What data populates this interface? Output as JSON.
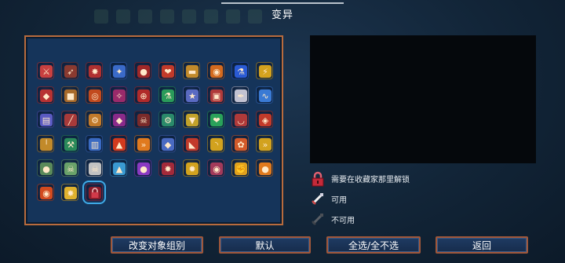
{
  "title": "变异",
  "grid": {
    "items": [
      {
        "name": "sword-mutation-icon",
        "glyph": "⚔",
        "color": "#c94040"
      },
      {
        "name": "crossbow-mutation-icon",
        "glyph": "➶",
        "color": "#8a3a30"
      },
      {
        "name": "spider-mutation-icon",
        "glyph": "✸",
        "color": "#b03030"
      },
      {
        "name": "blade-blue-mutation-icon",
        "glyph": "✦",
        "color": "#3a6ac9"
      },
      {
        "name": "red-orb-mutation-icon",
        "glyph": "●",
        "color": "#a02828"
      },
      {
        "name": "fire-heart-mutation-icon",
        "glyph": "❤",
        "color": "#c23a2a"
      },
      {
        "name": "gun-mutation-icon",
        "glyph": "▬",
        "color": "#c28a2a"
      },
      {
        "name": "pumpkin-mutation-icon",
        "glyph": "◉",
        "color": "#d46a1e"
      },
      {
        "name": "potion-blue-mutation-icon",
        "glyph": "⚗",
        "color": "#2a5ad4"
      },
      {
        "name": "lightning-mutation-icon",
        "glyph": "⚡",
        "color": "#d4a21e"
      },
      {
        "name": "shield-mutation-icon",
        "glyph": "◆",
        "color": "#b83232"
      },
      {
        "name": "barrel-mutation-icon",
        "glyph": "■",
        "color": "#a86a2a"
      },
      {
        "name": "ring-mutation-icon",
        "glyph": "◎",
        "color": "#c24a1e"
      },
      {
        "name": "claw-mutation-icon",
        "glyph": "✧",
        "color": "#9a2a6a"
      },
      {
        "name": "target-mutation-icon",
        "glyph": "⊕",
        "color": "#b02a2a"
      },
      {
        "name": "potion-green-mutation-icon",
        "glyph": "⚗",
        "color": "#2a9a5a"
      },
      {
        "name": "star-mutation-icon",
        "glyph": "★",
        "color": "#5a6ac2"
      },
      {
        "name": "chest-mutation-icon",
        "glyph": "▣",
        "color": "#b03a3a"
      },
      {
        "name": "key-mutation-icon",
        "glyph": "✒",
        "color": "#c2c2d2"
      },
      {
        "name": "wave-mutation-icon",
        "glyph": "∿",
        "color": "#3a7ad4"
      },
      {
        "name": "book-mutation-icon",
        "glyph": "▤",
        "color": "#5a5ac2"
      },
      {
        "name": "spear-mutation-icon",
        "glyph": "╱",
        "color": "#a83a3a"
      },
      {
        "name": "gear-mutation-icon",
        "glyph": "⚙",
        "color": "#c27a2a"
      },
      {
        "name": "drop-mutation-icon",
        "glyph": "◆",
        "color": "#8a2a8a"
      },
      {
        "name": "skull-mutation-icon",
        "glyph": "☠",
        "color": "#7a2a2a"
      },
      {
        "name": "cog-green-mutation-icon",
        "glyph": "⚙",
        "color": "#2a8a6a"
      },
      {
        "name": "cup-mutation-icon",
        "glyph": "▼",
        "color": "#c2a22a"
      },
      {
        "name": "heart-green-mutation-icon",
        "glyph": "❤",
        "color": "#2aa25a"
      },
      {
        "name": "bowl-mutation-icon",
        "glyph": "◡",
        "color": "#b03a3a"
      },
      {
        "name": "gem-mutation-icon",
        "glyph": "◈",
        "color": "#c23a2a"
      },
      {
        "name": "torch-mutation-icon",
        "glyph": "╵",
        "color": "#c28a2a"
      },
      {
        "name": "axe-mutation-icon",
        "glyph": "⚒",
        "color": "#2a8a5a"
      },
      {
        "name": "armor-mutation-icon",
        "glyph": "▥",
        "color": "#3a6ac2"
      },
      {
        "name": "flame-mutation-icon",
        "glyph": "▲",
        "color": "#d23a1e"
      },
      {
        "name": "chevrons-mutation-icon",
        "glyph": "»",
        "color": "#e07a1e"
      },
      {
        "name": "shield-blue-mutation-icon",
        "glyph": "◆",
        "color": "#4a6ac2"
      },
      {
        "name": "boot-mutation-icon",
        "glyph": "◣",
        "color": "#c23a2a"
      },
      {
        "name": "horn-mutation-icon",
        "glyph": "◝",
        "color": "#d2a21e"
      },
      {
        "name": "flower-mutation-icon",
        "glyph": "✿",
        "color": "#d25a2a"
      },
      {
        "name": "double-chevron-mutation-icon",
        "glyph": "»",
        "color": "#d2a21e"
      },
      {
        "name": "mask-mutation-icon",
        "glyph": "●",
        "color": "#5a8a5a"
      },
      {
        "name": "skull-green-mutation-icon",
        "glyph": "☠",
        "color": "#6aa26a"
      },
      {
        "name": "skull-white-mutation-icon",
        "glyph": "☠",
        "color": "#c2c2c2"
      },
      {
        "name": "cat-mutation-icon",
        "glyph": "▲",
        "color": "#3a9ad2"
      },
      {
        "name": "orb-purple-mutation-icon",
        "glyph": "●",
        "color": "#8a3ac2"
      },
      {
        "name": "crawler-mutation-icon",
        "glyph": "✸",
        "color": "#a22a3a"
      },
      {
        "name": "burst-mutation-icon",
        "glyph": "✹",
        "color": "#d2a21e"
      },
      {
        "name": "beast-mutation-icon",
        "glyph": "◉",
        "color": "#a23a5a"
      },
      {
        "name": "fist-mutation-icon",
        "glyph": "✊",
        "color": "#e0a21e"
      },
      {
        "name": "apple-mutation-icon",
        "glyph": "●",
        "color": "#e07a1e"
      },
      {
        "name": "fire-ring-mutation-icon",
        "glyph": "◉",
        "color": "#d24a1e"
      },
      {
        "name": "spark-blade-mutation-icon",
        "glyph": "✸",
        "color": "#e0b22e"
      },
      {
        "name": "locked-mutation-icon",
        "glyph": "■",
        "color": "#b0283a",
        "selected": true
      }
    ]
  },
  "legend": [
    {
      "name": "legend-locked",
      "label": "需要在收藏家那里解锁",
      "icon": "lock-icon"
    },
    {
      "name": "legend-available",
      "label": "可用",
      "icon": "sword-icon"
    },
    {
      "name": "legend-unavailable",
      "label": "不可用",
      "icon": "sword-grey-icon"
    }
  ],
  "buttons": [
    {
      "name": "change-target-group-button",
      "label": "改变对象组别"
    },
    {
      "name": "default-button",
      "label": "默认"
    },
    {
      "name": "select-all-none-button",
      "label": "全选/全不选"
    },
    {
      "name": "back-button",
      "label": "返回"
    }
  ],
  "colors": {
    "panel_border": "#b86b3d",
    "panel_fill": "#15345a",
    "selection": "#3fa9e6"
  }
}
